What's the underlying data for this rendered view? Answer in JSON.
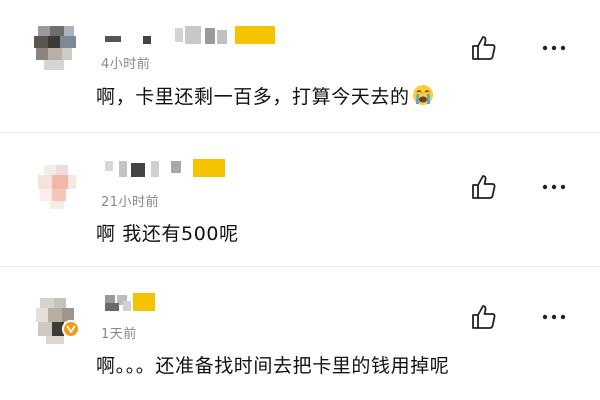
{
  "comments": [
    {
      "time": "4小时前",
      "text": "啊，卡里还剩一百多，打算今天去的",
      "emoji": "crying-face-emoji",
      "verified": false
    },
    {
      "time": "21小时前",
      "text": "啊 我还有500呢",
      "verified": false
    },
    {
      "time": "1天前",
      "text": "啊。。。还准备找时间去把卡里的钱用掉呢",
      "verified": true
    }
  ],
  "colors": {
    "username_accent": "#f5c400",
    "verified_badge": "#f59b13",
    "time_text": "#888888",
    "icon_stroke": "#222222"
  },
  "icons": {
    "like": "thumbs-up-icon",
    "more": "more-dots-icon"
  }
}
